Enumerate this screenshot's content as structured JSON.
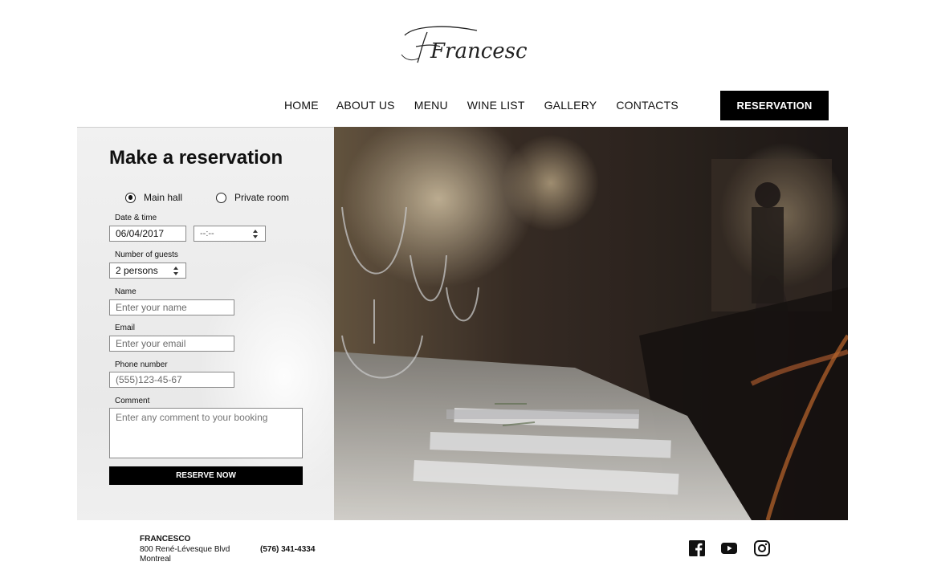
{
  "brand": {
    "logo_text": "Francesco"
  },
  "nav": {
    "items": [
      "HOME",
      "ABOUT US",
      "MENU",
      "WINE LIST",
      "GALLERY",
      "CONTACTS"
    ],
    "reservation_label": "RESERVATION"
  },
  "form": {
    "title": "Make a reservation",
    "rooms": [
      {
        "label": "Main hall",
        "selected": true
      },
      {
        "label": "Private room",
        "selected": false
      }
    ],
    "date_time_label": "Date & time",
    "date_value": "06/04/2017",
    "time_value": "--:--",
    "guests_label": "Number of guests",
    "guests_value": "2 persons",
    "name_label": "Name",
    "name_placeholder": "Enter your name",
    "email_label": "Email",
    "email_placeholder": "Enter your email",
    "phone_label": "Phone number",
    "phone_placeholder": "(555)123-45-67",
    "comment_label": "Comment",
    "comment_placeholder": "Enter any comment to your booking",
    "submit_label": "RESERVE NOW"
  },
  "footer": {
    "name": "FRANCESCO",
    "address_line1": "800 René-Lévesque Blvd",
    "address_line2": "Montreal",
    "phone": "(576) 341-4334",
    "social": [
      "facebook-icon",
      "youtube-icon",
      "instagram-icon"
    ]
  },
  "colors": {
    "primary": "#000000",
    "panel": "#eeeeee",
    "text": "#111111"
  }
}
